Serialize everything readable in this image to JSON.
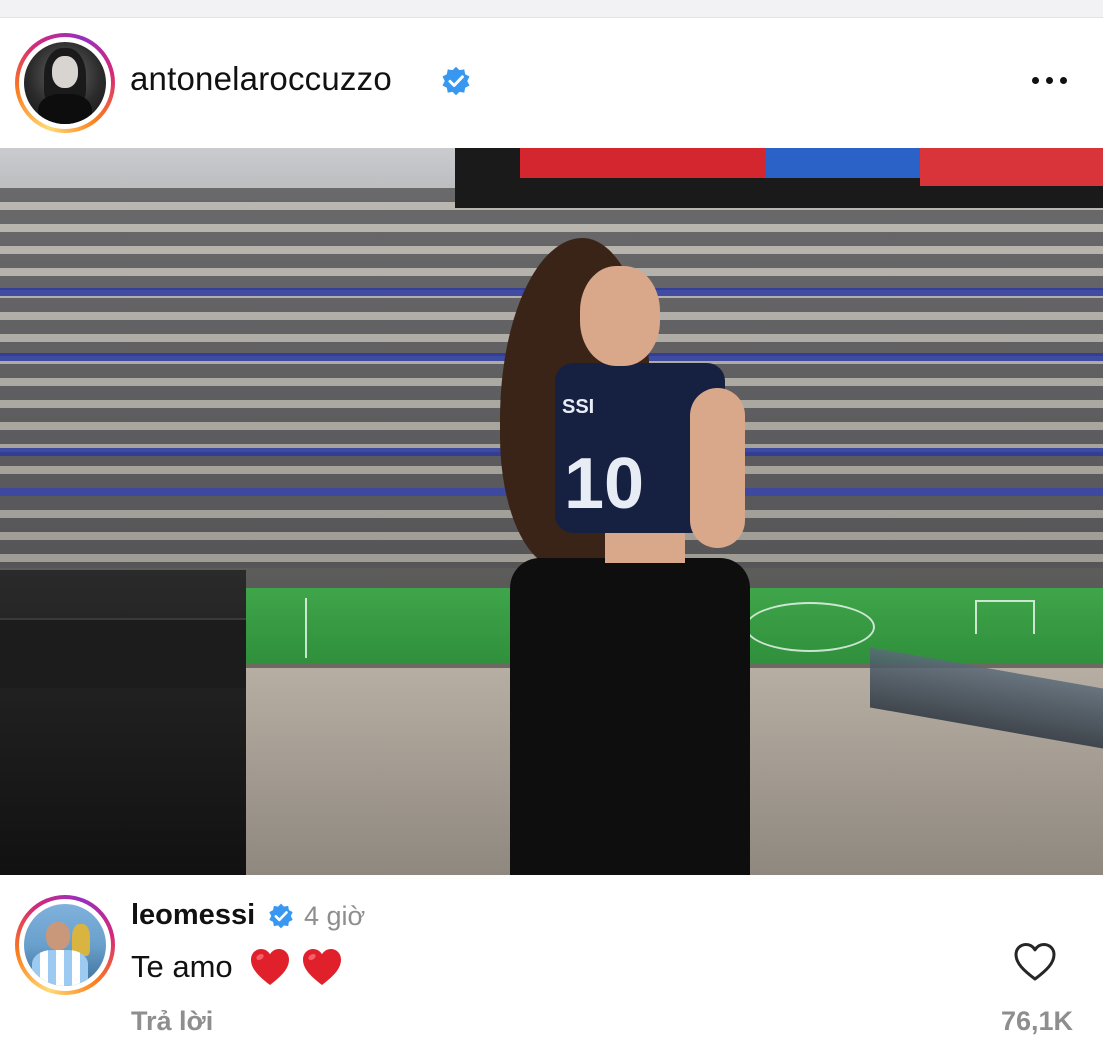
{
  "post": {
    "username": "antonelaroccuzzo",
    "verified": true,
    "more_icon": "more-horizontal-icon",
    "photo": {
      "jersey_name": "SSI",
      "jersey_number": "10"
    }
  },
  "comment": {
    "username": "leomessi",
    "verified": true,
    "time": "4 giờ",
    "text": "Te amo",
    "emojis": [
      "red-heart",
      "red-heart"
    ],
    "reply_label": "Trả lời",
    "like_icon": "heart-outline-icon",
    "like_count": "76,1K"
  },
  "colors": {
    "verified_blue": "#3897f0",
    "meta_gray": "#8e8e8e",
    "heart_red": "#e0202a"
  }
}
